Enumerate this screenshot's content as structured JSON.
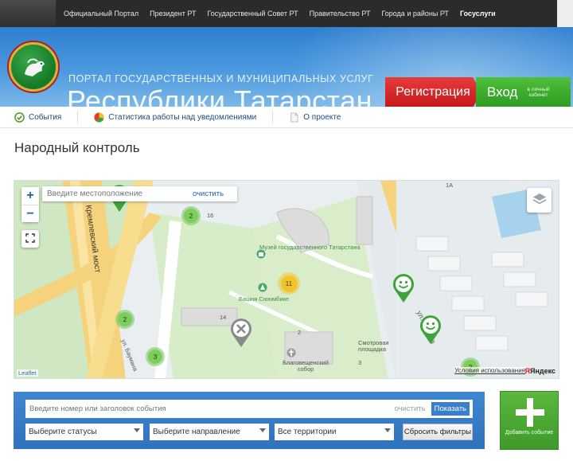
{
  "topnav": {
    "links": [
      {
        "label": "Официальный Портал"
      },
      {
        "label": "Президент РТ"
      },
      {
        "label": "Государственный Совет РТ"
      },
      {
        "label": "Правительство РТ"
      },
      {
        "label": "Города и районы РТ"
      },
      {
        "label": "Госуслуги",
        "active": true
      }
    ]
  },
  "header": {
    "subtitle": "ПОРТАЛ ГОСУДАРСТВЕННЫХ И МУНИЦИПАЛЬНЫХ УСЛУГ",
    "title": "Республики Татарстан",
    "register_label": "Регистрация",
    "login_label": "Вход",
    "login_sub": "в личный кабинет"
  },
  "tabs": [
    {
      "label": "События",
      "icon": "check-circle-icon"
    },
    {
      "label": "Статистика работы над уведомлениями",
      "icon": "pie-chart-icon"
    },
    {
      "label": "О проекте",
      "icon": "document-icon"
    }
  ],
  "page": {
    "title": "Народный контроль"
  },
  "map": {
    "location_placeholder": "Введите местоположение",
    "location_clear": "очистить",
    "zoom_in": "+",
    "zoom_out": "−",
    "clusters": [
      "2",
      "11",
      "2",
      "3",
      "2"
    ],
    "labels": {
      "museum": "Музей государственного Татарстана",
      "tower": "Башня Сююмбике",
      "platform": "Смотровая площадка",
      "cathedral": "Благовещенский собор",
      "street_baumana": "ул. Баумана",
      "street_urina": "ул. Зурина",
      "bridge": "Кремлевский мост",
      "num_14": "14",
      "num_16": "16",
      "num_2": "2",
      "num_1a": "1А",
      "num_3": "3"
    },
    "attribution": "Leaflet",
    "terms": "Условия использования",
    "provider": "Яндекс"
  },
  "search": {
    "placeholder": "Введите номер или заголовок события",
    "clear": "очистить",
    "show_label": "Показать",
    "status_select": "Выберите статусы",
    "direction_select": "Выберите направление",
    "territory_select": "Все территории",
    "reset_label": "Сбросить фильтры"
  },
  "add_event": {
    "label": "Добавить событие"
  },
  "colors": {
    "banner": "#3f8bd8",
    "register": "#d62525",
    "login": "#3aa82c",
    "cluster_green": "#7fcc5a",
    "cluster_yellow": "#f0c42c"
  }
}
